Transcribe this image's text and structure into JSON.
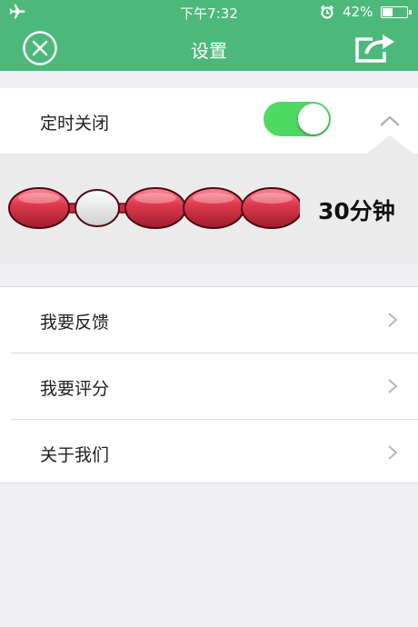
{
  "status_bar": {
    "time": "下午7:32",
    "battery": "42%",
    "battery_level": 0.42
  },
  "nav": {
    "title": "设置"
  },
  "timer": {
    "label": "定时关闭",
    "enabled": true,
    "value": "30分钟",
    "stops": 5,
    "selected_index": 1
  },
  "menu": [
    {
      "label": "我要反馈"
    },
    {
      "label": "我要评分"
    },
    {
      "label": "关于我们"
    }
  ],
  "colors": {
    "header_green": "#4cb97a",
    "toggle_on": "#4cd964",
    "bead_red": "#d8374a"
  },
  "icons": [
    "airplane-icon",
    "alarm-icon",
    "close-icon",
    "share-icon",
    "chevron-up-icon",
    "chevron-right-icon"
  ]
}
